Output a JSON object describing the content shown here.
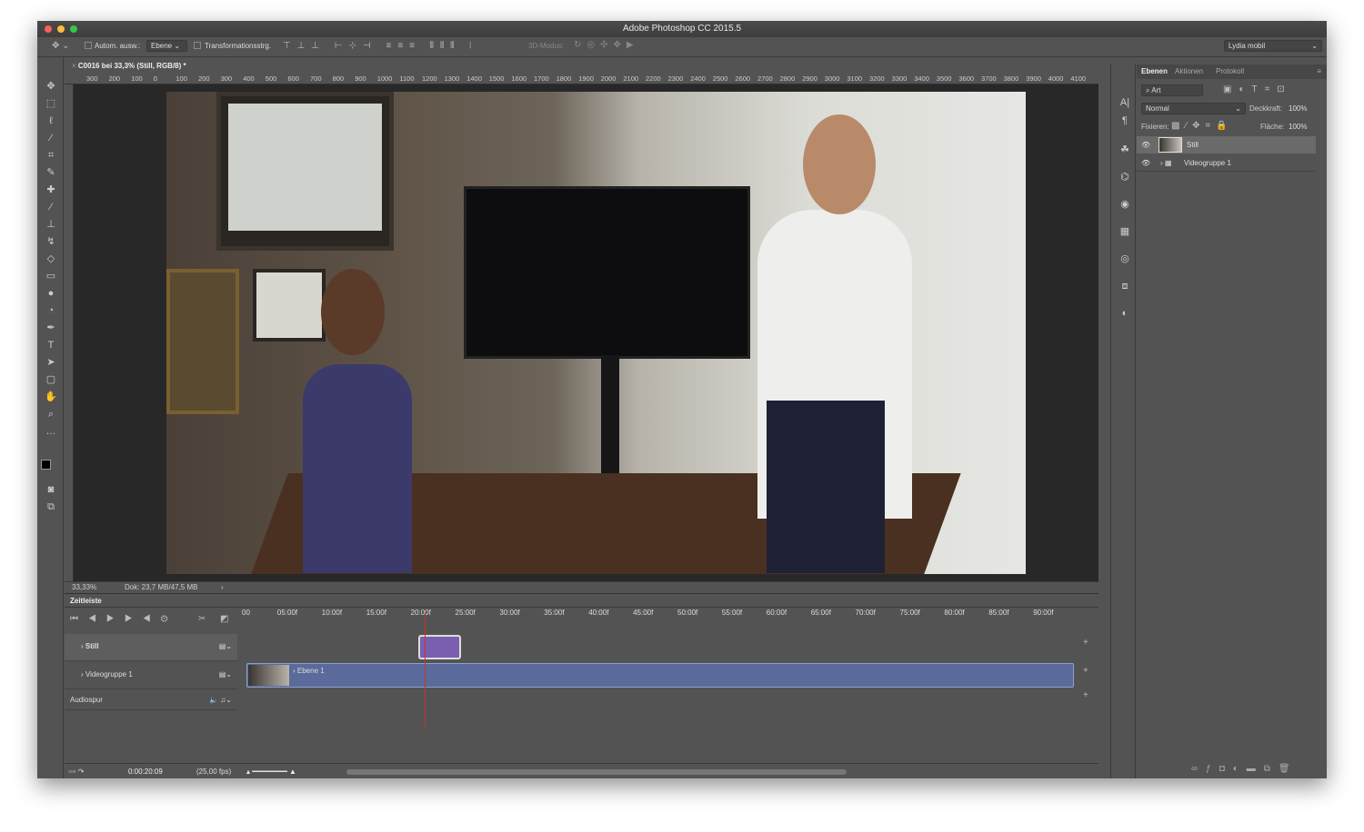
{
  "window": {
    "title": "Adobe Photoshop CC 2015.5"
  },
  "options": {
    "auto_select_label": "Autom. ausw.:",
    "auto_select_value": "Ebene",
    "transform_label": "Transformationsstrg.",
    "mode3d_label": "3D-Modus:",
    "workspace": "Lydia mobil"
  },
  "document": {
    "tab": "C0016 bei 33,3% (Still, RGB/8) *",
    "ruler": [
      "300",
      "200",
      "100",
      "0",
      "100",
      "200",
      "300",
      "400",
      "500",
      "600",
      "700",
      "800",
      "900",
      "1000",
      "1100",
      "1200",
      "1300",
      "1400",
      "1500",
      "1600",
      "1700",
      "1800",
      "1900",
      "2000",
      "2100",
      "2200",
      "2300",
      "2400",
      "2500",
      "2600",
      "2700",
      "2800",
      "2900",
      "3000",
      "3100",
      "3200",
      "3300",
      "3400",
      "3500",
      "3600",
      "3700",
      "3800",
      "3900",
      "4000",
      "4100"
    ]
  },
  "status": {
    "zoom": "33,33%",
    "doc": "Dok: 23,7 MB/47,5 MB",
    "arrow": "›"
  },
  "timeline": {
    "title": "Zeitleiste",
    "ticks": [
      "00",
      "05:00f",
      "10:00f",
      "15:00f",
      "20:00f",
      "25:00f",
      "30:00f",
      "35:00f",
      "40:00f",
      "45:00f",
      "50:00f",
      "55:00f",
      "60:00f",
      "65:00f",
      "70:00f",
      "75:00f",
      "80:00f",
      "85:00f",
      "90:00f"
    ],
    "tracks": [
      {
        "name": "Still"
      },
      {
        "name": "Videogruppe 1",
        "clip": "Ebene 1"
      },
      {
        "name": "Audiospur"
      }
    ],
    "timecode": "0:00:20:09",
    "fps": "(25,00 fps)",
    "playhead_fraction": 0.222,
    "clip_color": "#7a5fb0",
    "video_color": "#5a6a9a",
    "playhead_color": "#c0392b"
  },
  "layers_panel": {
    "tabs": [
      "Ebenen",
      "Aktionen",
      "Protokoll"
    ],
    "filter": "Art",
    "blend_mode": "Normal",
    "opacity_label": "Deckkraft:",
    "opacity": "100%",
    "lock_label": "Fixieren:",
    "fill_label": "Fläche:",
    "fill": "100%",
    "layers": [
      {
        "name": "Still",
        "selected": true
      },
      {
        "name": "Videogruppe 1",
        "selected": false
      }
    ]
  }
}
